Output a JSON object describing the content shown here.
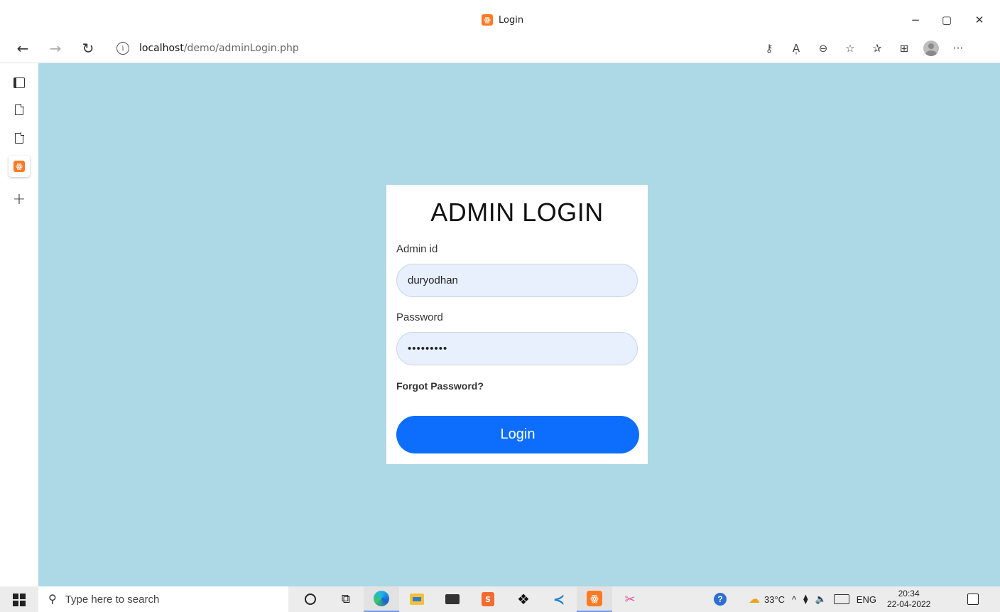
{
  "browser": {
    "tab_title": "Login",
    "url_host": "localhost",
    "url_path": "/demo/adminLogin.php",
    "window_controls": {
      "minimize": "−",
      "maximize": "▢",
      "close": "✕"
    },
    "nav": {
      "back": "←",
      "forward": "→",
      "reload": "↻"
    },
    "toolbar_icons": [
      "key-icon",
      "read-aloud-icon",
      "zoom-out-icon",
      "add-favorite-icon",
      "favorites-icon",
      "collections-icon",
      "profile-avatar",
      "more-icon"
    ],
    "toolbar_glyphs": {
      "key": "⚷",
      "read_aloud": "A̩",
      "zoom_out": "⊖",
      "add_favorite": "☆",
      "favorites": "✰",
      "collections": "⊞",
      "more": "···"
    },
    "sidebar": {
      "new_tab": "+"
    }
  },
  "login": {
    "title": "ADMIN LOGIN",
    "admin_id_label": "Admin id",
    "admin_id_value": "duryodhan",
    "password_label": "Password",
    "password_value": "•••••••••",
    "forgot_link": "Forgot Password?",
    "login_button": "Login"
  },
  "taskbar": {
    "search_placeholder": "Type here to search",
    "temperature": "33°C",
    "language": "ENG",
    "time": "20:34",
    "date": "22-04-2022",
    "tray_chevron": "^"
  },
  "colors": {
    "page_background": "#add8e6",
    "button_blue": "#0d6efd",
    "input_fill": "#e8f0fe",
    "xampp_orange": "#fb7a24"
  }
}
